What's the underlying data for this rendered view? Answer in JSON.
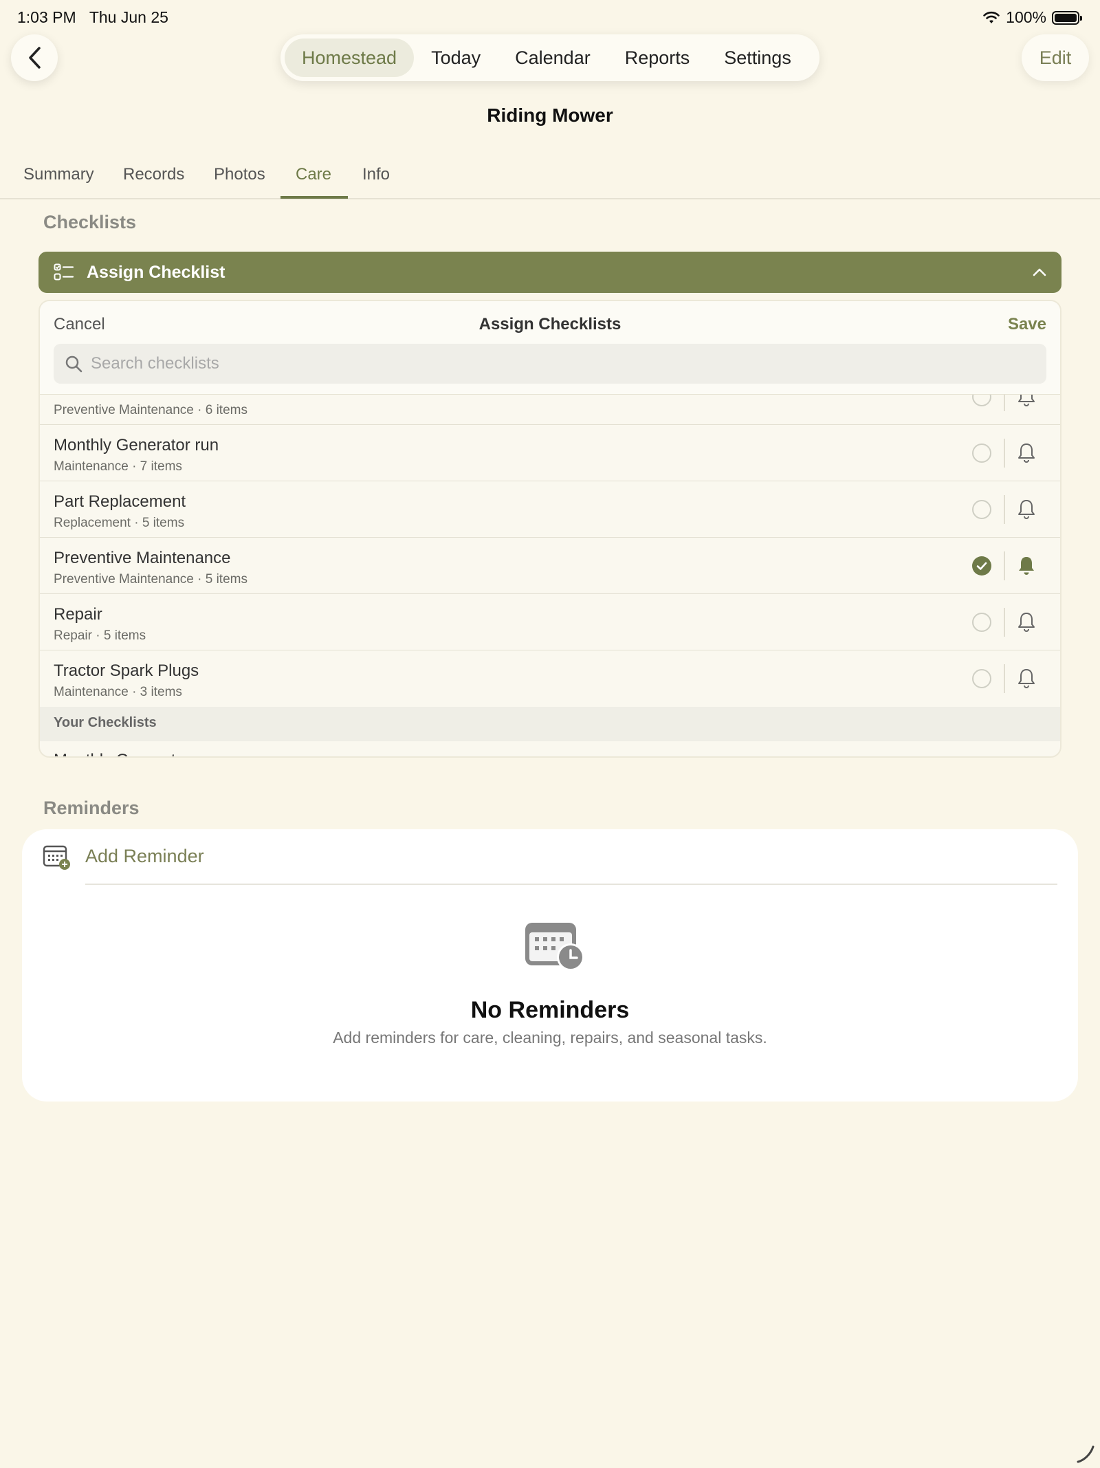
{
  "status": {
    "time": "1:03 PM",
    "date": "Thu Jun 25",
    "battery": "100%"
  },
  "nav": {
    "tabs": [
      "Homestead",
      "Today",
      "Calendar",
      "Reports",
      "Settings"
    ],
    "active": "Homestead",
    "edit_label": "Edit"
  },
  "title": "Riding Mower",
  "subtabs": {
    "items": [
      "Summary",
      "Records",
      "Photos",
      "Care",
      "Info"
    ],
    "active": "Care"
  },
  "checklists": {
    "section_label": "Checklists",
    "assign_label": "Assign Checklist",
    "panel": {
      "cancel": "Cancel",
      "title": "Assign Checklists",
      "save": "Save",
      "search_placeholder": "Search checklists",
      "rows": [
        {
          "title": "",
          "subtitle": "Preventive Maintenance · 6 items",
          "checked": false
        },
        {
          "title": "Monthly Generator run",
          "subtitle": "Maintenance · 7 items",
          "checked": false
        },
        {
          "title": "Part Replacement",
          "subtitle": "Replacement · 5 items",
          "checked": false
        },
        {
          "title": "Preventive Maintenance",
          "subtitle": "Preventive Maintenance · 5 items",
          "checked": true
        },
        {
          "title": "Repair",
          "subtitle": "Repair · 5 items",
          "checked": false
        },
        {
          "title": "Tractor Spark Plugs",
          "subtitle": "Maintenance · 3 items",
          "checked": false
        }
      ],
      "your_header": "Your Checklists",
      "partial_row": "Monthly Generator run"
    }
  },
  "reminders": {
    "section_label": "Reminders",
    "add_label": "Add Reminder",
    "empty_title": "No Reminders",
    "empty_subtitle": "Add reminders for care, cleaning, repairs, and seasonal tasks."
  },
  "colors": {
    "accent": "#7a834f",
    "background": "#faf6e8"
  }
}
